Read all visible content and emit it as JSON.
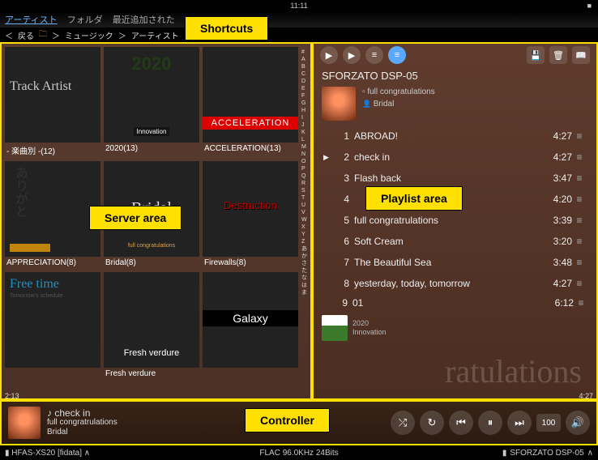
{
  "status": {
    "time": "11:11",
    "battery": "■"
  },
  "topbar": {
    "tab_artist": "アーティスト",
    "tab_folder": "フォルダ",
    "tab_recent": "最近追加された"
  },
  "crumb": {
    "back": "戻る",
    "path1": "ミュージック",
    "path2": "アーティスト"
  },
  "alpha": [
    "#",
    "A",
    "B",
    "C",
    "D",
    "E",
    "F",
    "G",
    "H",
    "I",
    "J",
    "K",
    "L",
    "M",
    "N",
    "O",
    "P",
    "Q",
    "R",
    "S",
    "T",
    "U",
    "V",
    "W",
    "X",
    "Y",
    "Z",
    "あ",
    "か",
    "さ",
    "た",
    "な",
    "は",
    "ま"
  ],
  "albums": [
    {
      "art": "art1",
      "overlay": "Track Artist",
      "label": "- 楽曲別 -(12)"
    },
    {
      "art": "art2",
      "overlay": "2020",
      "sub": "Innovation",
      "label": "2020(13)"
    },
    {
      "art": "art3",
      "overlay": "ACCELERATION",
      "label": "ACCELERATION(13)"
    },
    {
      "art": "art4",
      "overlay": "ありがと",
      "label": "APPRECIATION(8)"
    },
    {
      "art": "art5",
      "overlay": "Bridal",
      "sub": "full congratulations",
      "label": "Bridal(8)"
    },
    {
      "art": "art6",
      "overlay": "Destruction",
      "label": "Firewalls(8)"
    },
    {
      "art": "art7",
      "overlay": "Free time",
      "sub": "Tomorrow's schedule",
      "label": ""
    },
    {
      "art": "art8",
      "overlay": "Fresh verdure",
      "label": "Fresh verdure"
    },
    {
      "art": "art9",
      "overlay": "Galaxy",
      "label": ""
    }
  ],
  "annot": {
    "shortcuts": "Shortcuts",
    "server": "Server area",
    "playlist": "Playlist area",
    "controller": "Controller"
  },
  "playlist": {
    "renderer": "SFORZATO DSP-05",
    "album": "full congratulations",
    "artist": "Bridal",
    "tracks": [
      {
        "n": "1",
        "t": "ABROAD!",
        "d": "4:27",
        "play": ""
      },
      {
        "n": "2",
        "t": "check in",
        "d": "4:27",
        "play": "▶"
      },
      {
        "n": "3",
        "t": "Flash back",
        "d": "3:47",
        "play": ""
      },
      {
        "n": "4",
        "t": "",
        "d": "4:20",
        "play": ""
      },
      {
        "n": "5",
        "t": "full congratrulations",
        "d": "3:39",
        "play": ""
      },
      {
        "n": "6",
        "t": "Soft Cream",
        "d": "3:20",
        "play": ""
      },
      {
        "n": "7",
        "t": "The Beautiful Sea",
        "d": "3:48",
        "play": ""
      },
      {
        "n": "8",
        "t": "yesterday, today, tomorrow",
        "d": "4:27",
        "play": ""
      }
    ],
    "next": {
      "n": "9",
      "t": "01",
      "d": "6:12",
      "album": "2020",
      "artist": "Innovation"
    },
    "bg": "ratulations"
  },
  "nowplaying": {
    "title": "check in",
    "album": "full congratrulations",
    "artist": "Bridal",
    "elapsed": "2:13",
    "remain": "4:27",
    "vol": "100"
  },
  "bottom": {
    "server": "HFAS-XS20 [fidata]",
    "format": "FLAC 96.0KHz 24Bits",
    "renderer": "SFORZATO DSP-05"
  }
}
